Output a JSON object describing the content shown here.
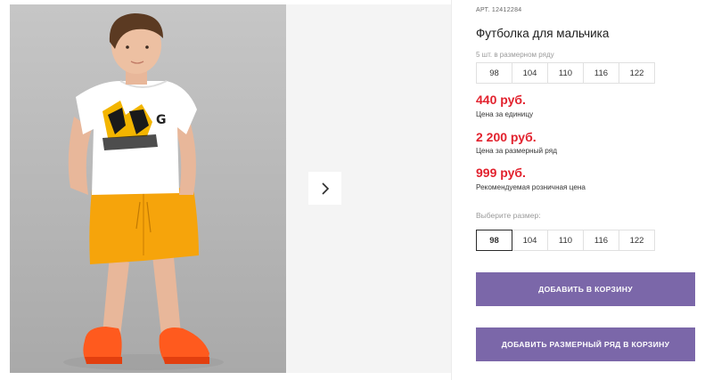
{
  "gallery": {
    "photo_alt": "Мальчик в футболке и оранжевых шортах",
    "next_icon": "chevron-right-icon",
    "colors": {
      "backdrop": "#b9b9b9",
      "panel": "#f4f4f4"
    }
  },
  "product": {
    "article_label": "АРТ.",
    "article_value": "12412284",
    "title": "Футболка для мальчика",
    "series_hint": "5 шт. в размерном ряду",
    "series_sizes": [
      "98",
      "104",
      "110",
      "116",
      "122"
    ],
    "prices": [
      {
        "amount": "440 руб.",
        "note": "Цена за единицу"
      },
      {
        "amount": "2 200 руб.",
        "note": "Цена за размерный ряд"
      },
      {
        "amount": "999 руб.",
        "note": "Рекомендуемая розничная цена"
      }
    ],
    "choose_label": "Выберите размер:",
    "choose_sizes": [
      "98",
      "104",
      "110",
      "116",
      "122"
    ],
    "selected_size": "98"
  },
  "actions": {
    "add_to_cart": "ДОБАВИТЬ В КОРЗИНУ",
    "add_series_to_cart": "ДОБАВИТЬ РАЗМЕРНЫЙ РЯД В КОРЗИНУ"
  },
  "colors": {
    "price": "#e2222e",
    "button": "#7b67a9",
    "button_text": "#ffffff"
  }
}
